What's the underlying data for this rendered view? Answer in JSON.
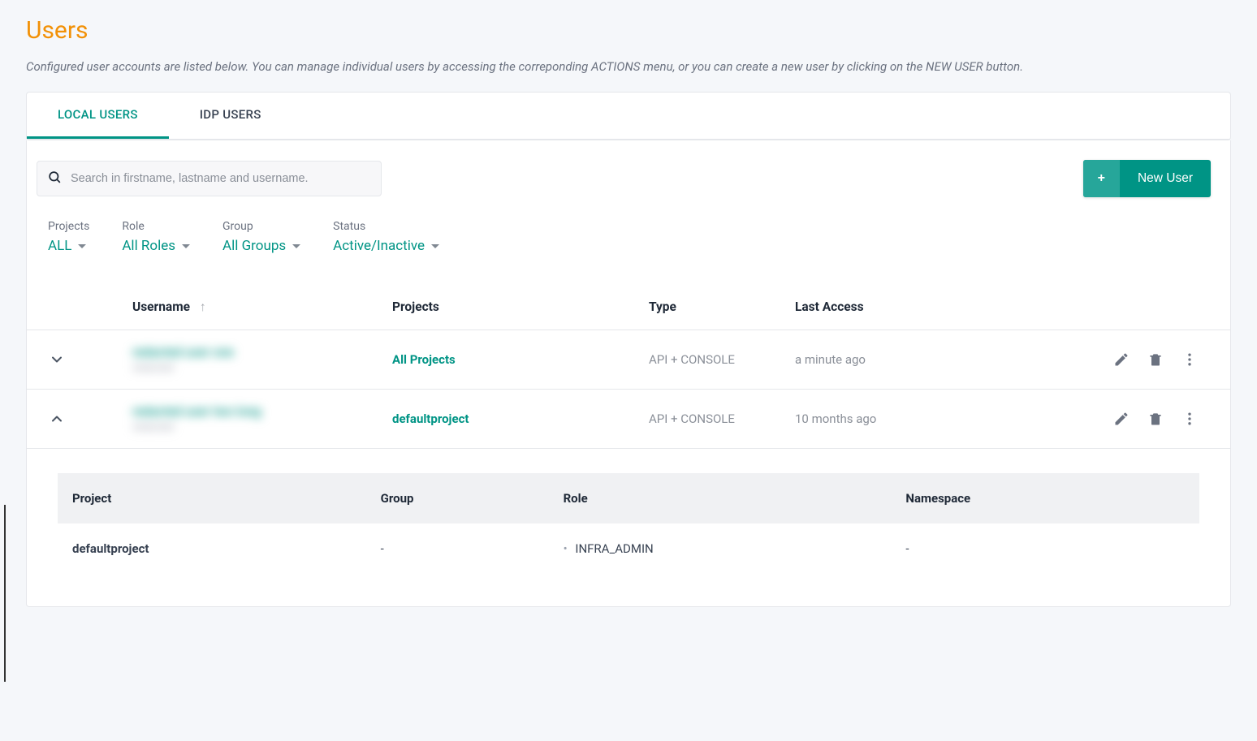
{
  "page": {
    "title": "Users",
    "subtitle": "Configured user accounts are listed below. You can manage individual users by accessing the correponding ACTIONS menu, or you can create a new user by clicking on the NEW USER button."
  },
  "tabs": [
    {
      "label": "LOCAL USERS",
      "active": true
    },
    {
      "label": "IDP USERS",
      "active": false
    }
  ],
  "search": {
    "placeholder": "Search in firstname, lastname and username."
  },
  "new_user_button": "New User",
  "filters": {
    "projects": {
      "label": "Projects",
      "value": "ALL"
    },
    "role": {
      "label": "Role",
      "value": "All Roles"
    },
    "group": {
      "label": "Group",
      "value": "All Groups"
    },
    "status": {
      "label": "Status",
      "value": "Active/Inactive"
    }
  },
  "columns": {
    "username": "Username",
    "projects": "Projects",
    "type": "Type",
    "last_access": "Last Access"
  },
  "rows": [
    {
      "expanded": false,
      "user_primary": "redacted user one",
      "user_secondary": "redacted",
      "projects": "All Projects",
      "type": "API + CONSOLE",
      "last_access": "a minute ago"
    },
    {
      "expanded": true,
      "user_primary": "redacted user two long",
      "user_secondary": "redacted",
      "projects": "defaultproject",
      "type": "API + CONSOLE",
      "last_access": "10 months ago"
    }
  ],
  "detail": {
    "headers": {
      "project": "Project",
      "group": "Group",
      "role": "Role",
      "namespace": "Namespace"
    },
    "row": {
      "project": "defaultproject",
      "group": "-",
      "role": "INFRA_ADMIN",
      "namespace": "-"
    }
  }
}
